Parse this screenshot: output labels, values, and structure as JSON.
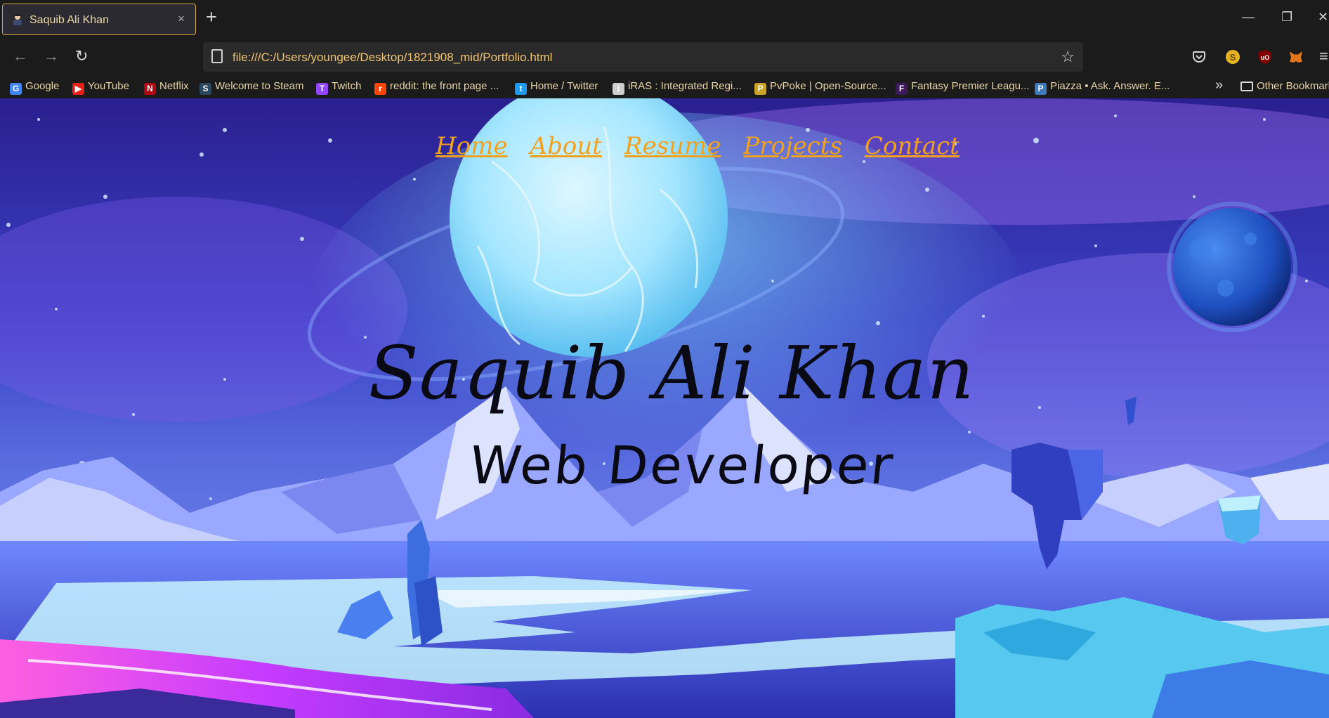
{
  "browser": {
    "tab": {
      "title": "Saquib Ali Khan",
      "close": "×"
    },
    "new_tab": "+",
    "window": {
      "minimize": "—",
      "restore": "❐",
      "close": "✕"
    },
    "nav": {
      "back": "←",
      "forward": "→",
      "reload": "↻"
    },
    "url": "file:///C:/Users/youngee/Desktop/1821908_mid/Portfolio.html",
    "bookmark_star": "☆",
    "bookmarks": [
      {
        "label": "Google",
        "icon": "google-icon",
        "color": "#4285f4",
        "glyph": "G"
      },
      {
        "label": "YouTube",
        "icon": "youtube-icon",
        "color": "#e62117",
        "glyph": "▶"
      },
      {
        "label": "Netflix",
        "icon": "netflix-icon",
        "color": "#b20710",
        "glyph": "N"
      },
      {
        "label": "Welcome to Steam",
        "icon": "steam-icon",
        "color": "#2a475e",
        "glyph": "S"
      },
      {
        "label": "Twitch",
        "icon": "twitch-icon",
        "color": "#9146ff",
        "glyph": "T"
      },
      {
        "label": "reddit: the front page ...",
        "icon": "reddit-icon",
        "color": "#ff4500",
        "glyph": "r"
      },
      {
        "label": "Home / Twitter",
        "icon": "twitter-icon",
        "color": "#1d9bf0",
        "glyph": "t"
      },
      {
        "label": "iRAS : Integrated Regi...",
        "icon": "iras-icon",
        "color": "#cfcfcf",
        "glyph": "i"
      },
      {
        "label": "PvPoke | Open-Source...",
        "icon": "pvpoke-icon",
        "color": "#c9a227",
        "glyph": "P"
      },
      {
        "label": "Fantasy Premier Leagu...",
        "icon": "premier-league-icon",
        "color": "#3d195b",
        "glyph": "F"
      },
      {
        "label": "Piazza • Ask. Answer. E...",
        "icon": "piazza-icon",
        "color": "#3e7ab9",
        "glyph": "P"
      }
    ],
    "bookmarks_overflow": "»",
    "other_bookmarks": "Other Bookmarks"
  },
  "site": {
    "nav": [
      "Home",
      "About",
      "Resume",
      "Projects",
      "Contact"
    ],
    "name": "Saquib Ali Khan",
    "role": "Web Developer",
    "accent_color": "#f2a11f"
  }
}
